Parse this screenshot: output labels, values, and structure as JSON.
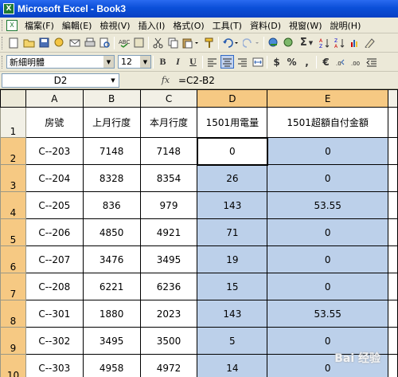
{
  "window": {
    "title": "Microsoft Excel - Book3",
    "app_icon": "excel-icon"
  },
  "menu": [
    "檔案(F)",
    "編輯(E)",
    "檢視(V)",
    "插入(I)",
    "格式(O)",
    "工具(T)",
    "資料(D)",
    "視窗(W)",
    "說明(H)"
  ],
  "toolbar1": {
    "autosum_label": "Σ"
  },
  "toolbar2": {
    "font_name": "新細明體",
    "font_size": "12",
    "bold": "B",
    "italic": "I",
    "underline": "U",
    "currency": "$",
    "percent": "%",
    "comma": ",",
    "euro": "€"
  },
  "formula_bar": {
    "name_box": "D2",
    "fx": "fx",
    "formula": "=C2-B2"
  },
  "sheet": {
    "columns": [
      "A",
      "B",
      "C",
      "D",
      "E"
    ],
    "rows": [
      {
        "num": "1",
        "cells": [
          "房號",
          "上月行度",
          "本月行度",
          "1501用電量",
          "1501超額自付金額"
        ]
      },
      {
        "num": "2",
        "cells": [
          "C--203",
          "7148",
          "7148",
          "0",
          "0"
        ]
      },
      {
        "num": "3",
        "cells": [
          "C--204",
          "8328",
          "8354",
          "26",
          "0"
        ]
      },
      {
        "num": "4",
        "cells": [
          "C--205",
          "836",
          "979",
          "143",
          "53.55"
        ]
      },
      {
        "num": "5",
        "cells": [
          "C--206",
          "4850",
          "4921",
          "71",
          "0"
        ]
      },
      {
        "num": "6",
        "cells": [
          "C--207",
          "3476",
          "3495",
          "19",
          "0"
        ]
      },
      {
        "num": "7",
        "cells": [
          "C--208",
          "6221",
          "6236",
          "15",
          "0"
        ]
      },
      {
        "num": "8",
        "cells": [
          "C--301",
          "1880",
          "2023",
          "143",
          "53.55"
        ]
      },
      {
        "num": "9",
        "cells": [
          "C--302",
          "3495",
          "3500",
          "5",
          "0"
        ]
      },
      {
        "num": "10",
        "cells": [
          "C--303",
          "4958",
          "4972",
          "14",
          "0"
        ]
      }
    ],
    "selection_color": "#bcd0ea",
    "header_highlight_color": "#f6c983"
  },
  "watermark": "Bai 经验"
}
